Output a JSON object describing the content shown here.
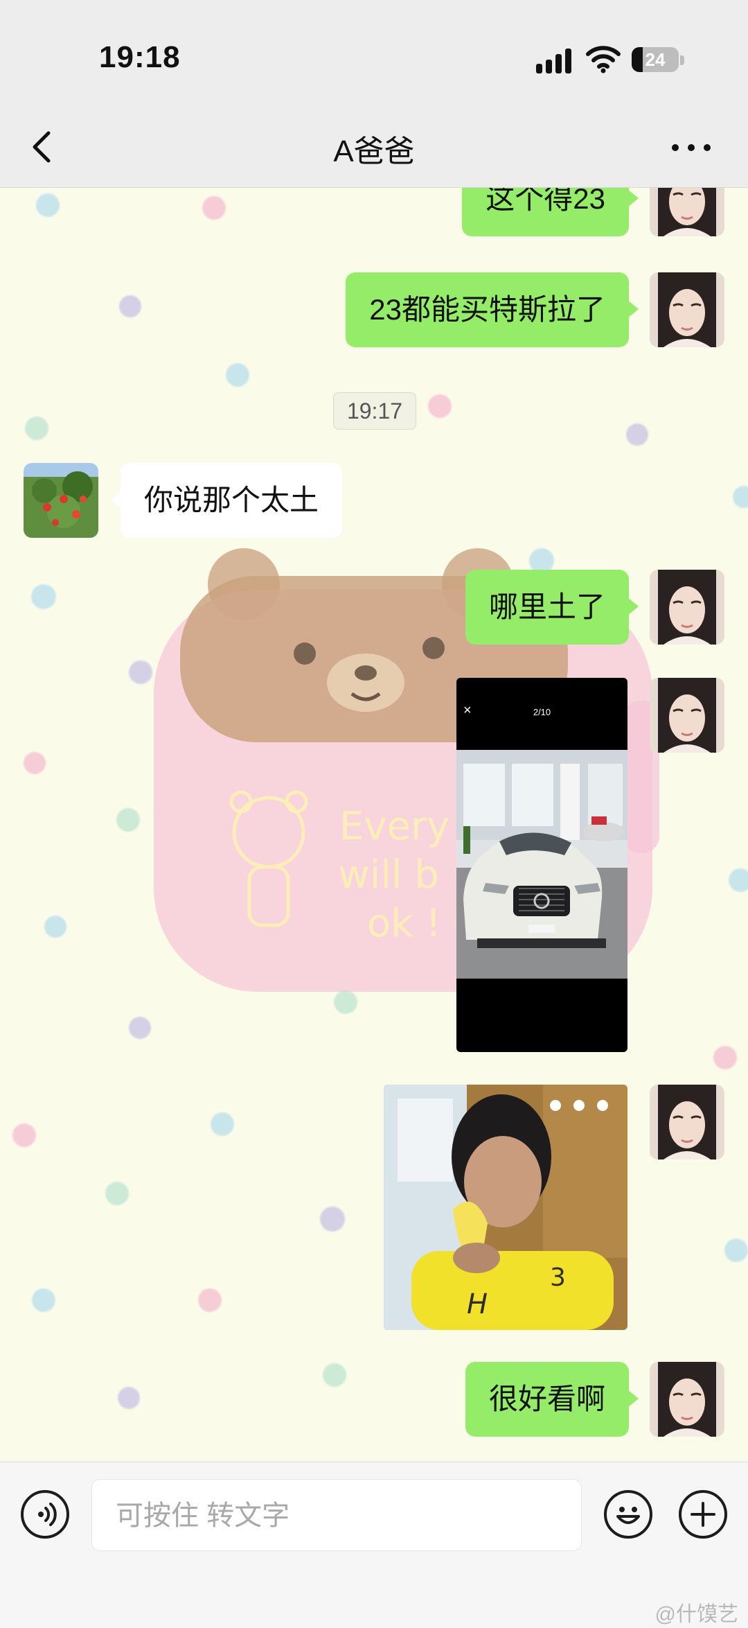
{
  "status_bar": {
    "time": "19:18",
    "battery": "24",
    "battery_level": 0.24
  },
  "header": {
    "title": "A爸爸",
    "back_icon": "chevron-left-icon",
    "more_icon": "more-dots-icon"
  },
  "messages": [
    {
      "sender": "me",
      "type": "text",
      "text": "这个得23"
    },
    {
      "sender": "me",
      "type": "text",
      "text": "23都能买特斯拉了"
    },
    {
      "type": "timestamp",
      "text": "19:17"
    },
    {
      "sender": "other",
      "type": "text",
      "text": "你说那个太土"
    },
    {
      "sender": "me",
      "type": "text",
      "text": "哪里土了"
    },
    {
      "sender": "me",
      "type": "image",
      "description": "car-photo-screenshot",
      "close_text": "×",
      "counter": "2/10"
    },
    {
      "sender": "me",
      "type": "image",
      "description": "sticker-boy-eating-banana"
    },
    {
      "sender": "me",
      "type": "text",
      "text": "很好看啊"
    }
  ],
  "input": {
    "placeholder": "可按住 转文字",
    "voice_icon": "voice-icon",
    "emoji_icon": "emoji-icon",
    "plus_icon": "plus-icon"
  },
  "watermark": "@什馍艺",
  "colors": {
    "my_bubble": "#95ec69",
    "other_bubble": "#ffffff",
    "bar_bg": "#ededed",
    "chat_bg": "#fbfbea"
  }
}
